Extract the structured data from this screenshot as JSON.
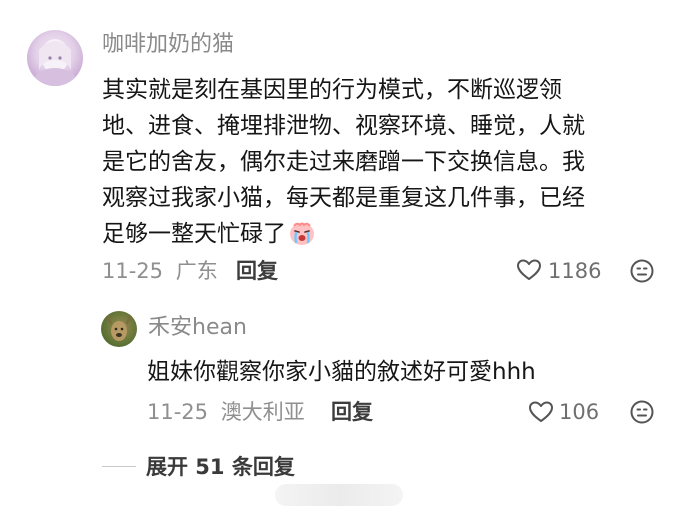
{
  "comment": {
    "author": "咖啡加奶的猫",
    "body_lines": [
      "其实就是刻在基因里的行为模式，不断巡逻领",
      "地、进食、掩埋排泄物、视察环境、睡觉，人就",
      "是它的舍友，偶尔走过来磨蹭一下交换信息。我",
      "观察过我家小猫，每天都是重复这几件事，已经",
      "足够一整天忙碌了"
    ],
    "emoji": "crying-face-emoji",
    "date": "11-25",
    "location": "广东",
    "reply_label": "回复",
    "likes": "1186"
  },
  "reply": {
    "author": "禾安hean",
    "body": "姐妹你觀察你家小貓的敘述好可愛hhh",
    "date": "11-25",
    "location": "澳大利亚",
    "reply_label": "回复",
    "likes": "106"
  },
  "expand_label": "展开 51 条回复",
  "colors": {
    "text_primary": "#161616",
    "text_secondary": "#8f8f8f",
    "avatar_main": "#c9a9d3",
    "avatar_reply": "#4e6a2e"
  }
}
